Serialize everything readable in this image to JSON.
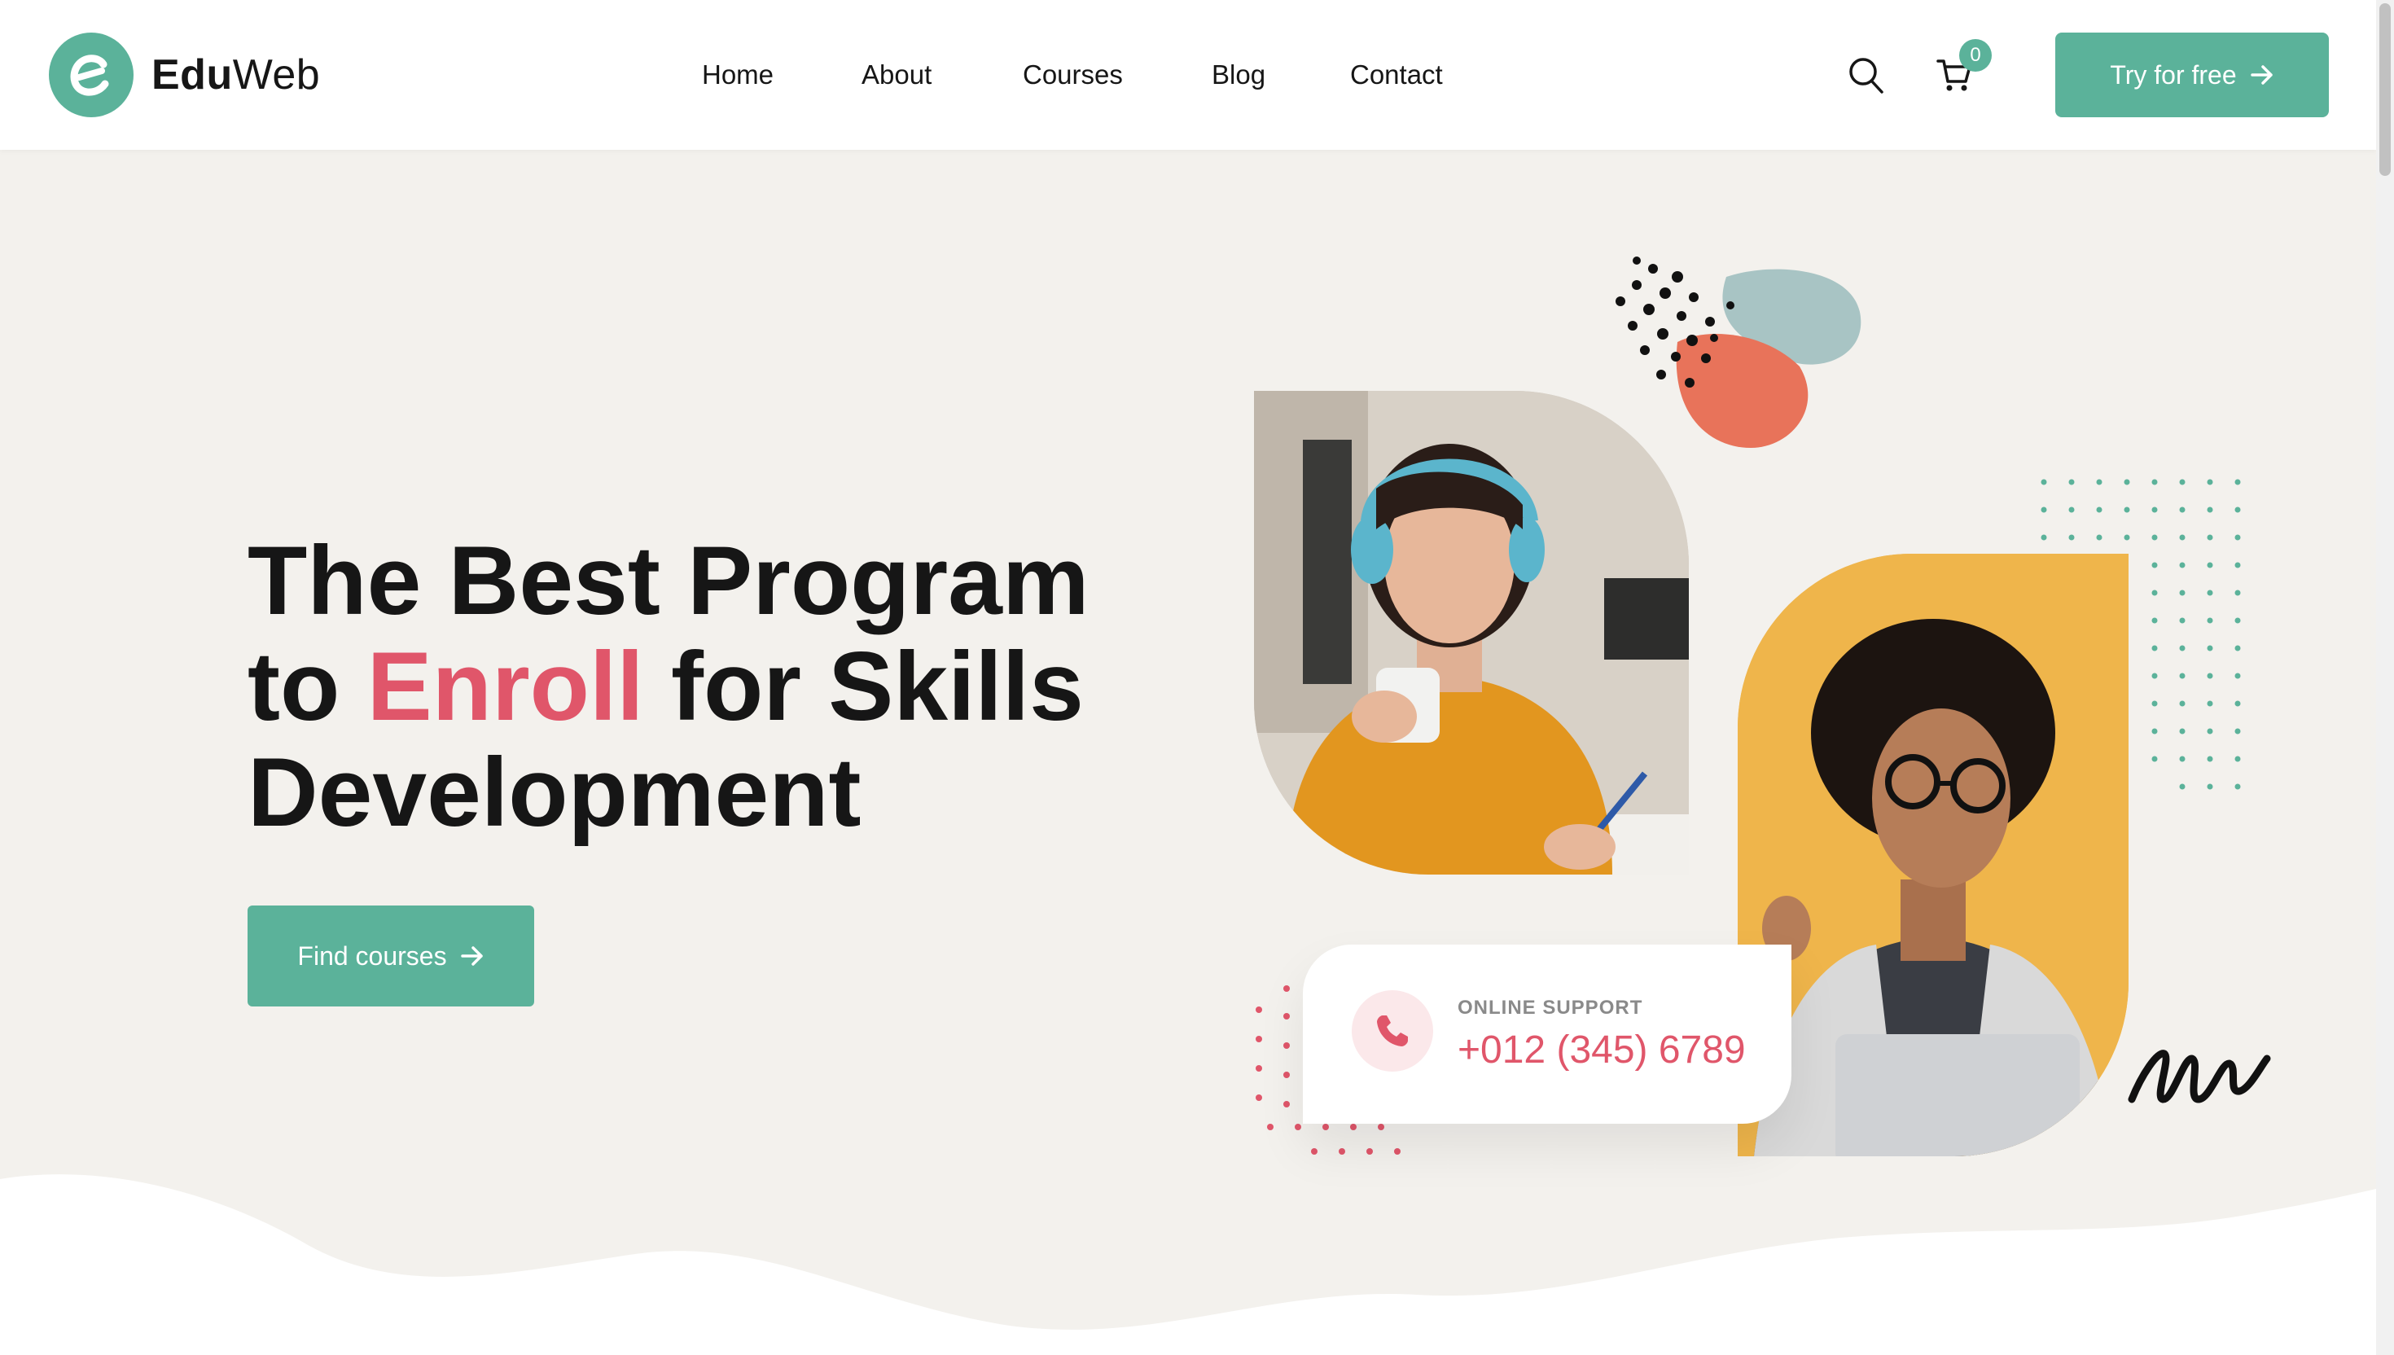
{
  "brand": {
    "bold": "Edu",
    "regular": "Web",
    "accent": "#5bb29a"
  },
  "nav": {
    "items": [
      {
        "label": "Home"
      },
      {
        "label": "About"
      },
      {
        "label": "Courses"
      },
      {
        "label": "Blog"
      },
      {
        "label": "Contact"
      }
    ]
  },
  "header": {
    "search_icon": "search-icon",
    "cart_icon": "cart-icon",
    "cart_count": "0",
    "cta_label": "Try for free"
  },
  "hero": {
    "title_line1": "The Best Program",
    "title_to": "to",
    "title_accent": "Enroll",
    "title_rest": "for Skills",
    "title_line3": "Development",
    "button_label": "Find courses"
  },
  "support": {
    "label": "ONLINE SUPPORT",
    "phone": "+012 (345) 6789",
    "icon": "phone-icon"
  },
  "colors": {
    "accent_green": "#5bb29a",
    "accent_pink": "#e0566a",
    "hero_bg": "#f3f1ed",
    "photo_yellow": "#efb54b",
    "blob_orange": "#e8735a",
    "blob_blue": "#a8c4c4"
  }
}
